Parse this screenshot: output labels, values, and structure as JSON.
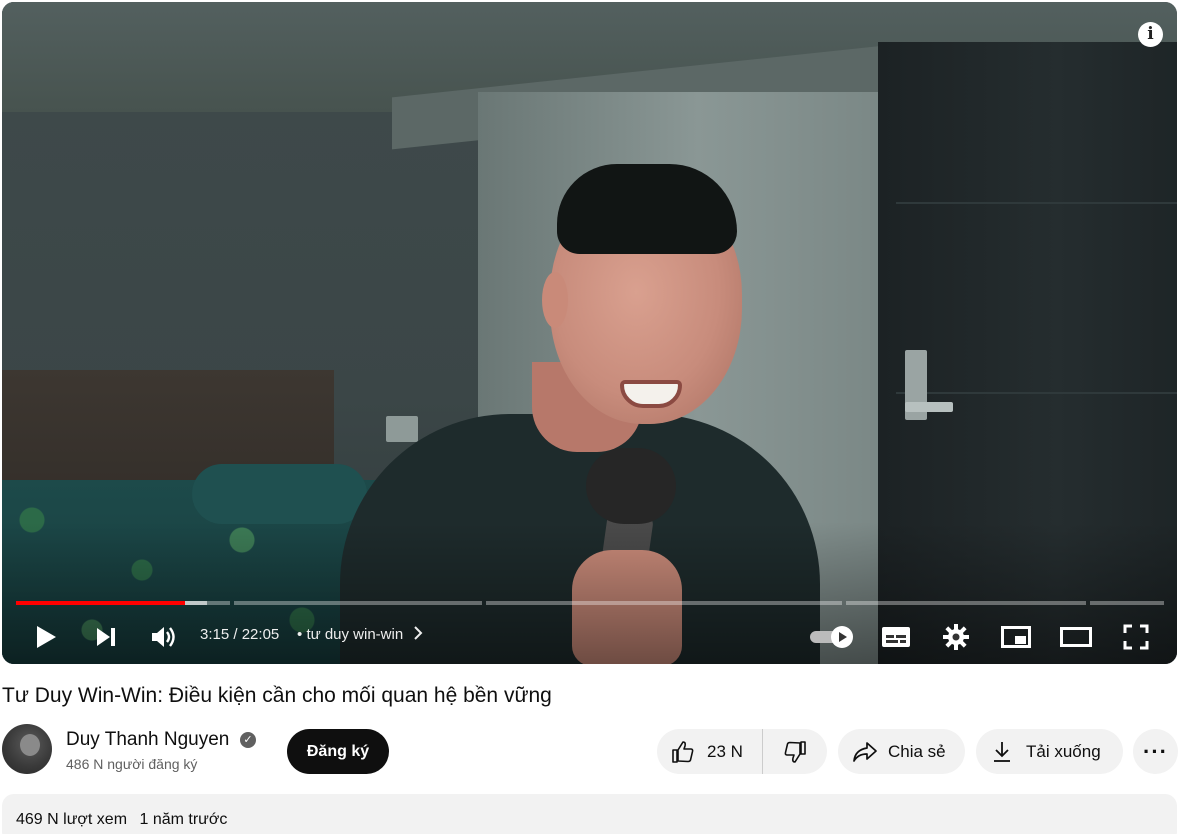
{
  "player": {
    "current_time": "3:15",
    "duration": "22:05",
    "time_separator": "/",
    "chapter_bullet": "•",
    "chapter_title": "tư duy win-win",
    "played_fraction": 0.147,
    "buffered_fraction": 0.166,
    "autoplay_on": true
  },
  "video": {
    "title": "Tư Duy Win-Win: Điều kiện cần cho mối quan hệ bền vững"
  },
  "channel": {
    "name": "Duy Thanh Nguyen",
    "subscribers": "486 N người đăng ký",
    "verified_mark": "✓",
    "subscribe_label": "Đăng ký"
  },
  "actions": {
    "like_count": "23 N",
    "share_label": "Chia sẻ",
    "download_label": "Tải xuống",
    "more_label": "···"
  },
  "description": {
    "views": "469 N lượt xem",
    "age": "1 năm trước"
  },
  "icons": {
    "info": "info-icon",
    "play": "play-icon",
    "next": "next-icon",
    "volume": "volume-icon",
    "autoplay": "autoplay-toggle-icon",
    "subtitles": "subtitles-icon",
    "settings": "gear-icon",
    "miniplayer": "miniplayer-icon",
    "theater": "theater-mode-icon",
    "fullscreen": "fullscreen-icon",
    "like": "thumbs-up-icon",
    "dislike": "thumbs-down-icon",
    "share": "share-icon",
    "download": "download-icon"
  },
  "colors": {
    "progress_played": "#ff0000",
    "subscribe_bg": "#0f0f0f",
    "pill_bg": "#f2f2f2"
  }
}
